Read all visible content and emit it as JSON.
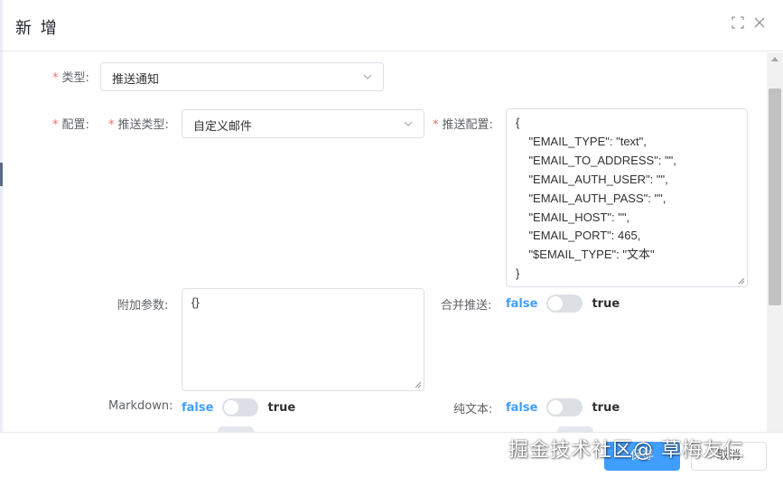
{
  "dialog": {
    "title": "新 增",
    "fullscreen_icon": "fullscreen-icon",
    "close_icon": "close-icon"
  },
  "form": {
    "type": {
      "label": "类型:",
      "value": "推送通知"
    },
    "config": {
      "label": "配置:",
      "push_type": {
        "label": "推送类型:",
        "value": "自定义邮件"
      },
      "push_config": {
        "label": "推送配置:",
        "value": "{\n    \"EMAIL_TYPE\": \"text\",\n    \"EMAIL_TO_ADDRESS\": \"\",\n    \"EMAIL_AUTH_USER\": \"\",\n    \"EMAIL_AUTH_PASS\": \"\",\n    \"EMAIL_HOST\": \"\",\n    \"EMAIL_PORT\": 465,\n    \"$EMAIL_TYPE\": \"文本\"\n}"
      }
    },
    "extra_params": {
      "label": "附加参数:",
      "value": "{}"
    },
    "merge_push": {
      "label": "合并推送:",
      "off_text": "false",
      "on_text": "true",
      "value": false
    },
    "markdown": {
      "label": "Markdown:",
      "off_text": "false",
      "on_text": "true",
      "value": false
    },
    "plain_text": {
      "label": "纯文本:",
      "off_text": "false",
      "on_text": "true",
      "value": false
    }
  },
  "footer": {
    "save_label": "保存",
    "cancel_label": "取消"
  },
  "watermark": "掘金技术社区@ 草梅友仁",
  "colors": {
    "primary": "#409eff",
    "required": "#f56c6c",
    "border": "#dcdfe6",
    "switch_off": "#dcdfe6"
  }
}
